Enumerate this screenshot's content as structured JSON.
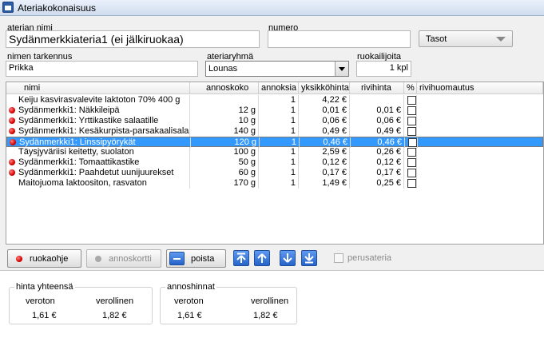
{
  "window": {
    "title": "Ateriakokonaisuus"
  },
  "form": {
    "aterian_nimi_label": "aterian nimi",
    "aterian_nimi": "Sydänmerkkiateria1 (ei jälkiruokaa)",
    "numero_label": "numero",
    "numero": "",
    "tasot": "Tasot",
    "nimen_tarkennus_label": "nimen tarkennus",
    "nimen_tarkennus": "Prikka",
    "ateriaryhma_label": "ateriaryhmä",
    "ateriaryhma": "Lounas",
    "ruokailijoita_label": "ruokailijoita",
    "ruokailijoita": "1 kpl"
  },
  "table": {
    "headers": [
      "nimi",
      "annoskoko",
      "annoksia",
      "yksikköhinta",
      "rivihinta",
      "%",
      "rivihuomautus"
    ],
    "rows": [
      {
        "mark": false,
        "nimi": "Keiju kasvirasvalevite laktoton 70% 400 g",
        "annoskoko": "",
        "annoksia": "1",
        "yksikkohinta": "4,22 €",
        "rivihinta": "",
        "selected": false
      },
      {
        "mark": true,
        "nimi": "Sydänmerkki1: Näkkileipä",
        "annoskoko": "12 g",
        "annoksia": "1",
        "yksikkohinta": "0,01 €",
        "rivihinta": "0,01 €",
        "selected": false
      },
      {
        "mark": true,
        "nimi": "Sydänmerkki1: Yrttikastike salaatille",
        "annoskoko": "10 g",
        "annoksia": "1",
        "yksikkohinta": "0,06 €",
        "rivihinta": "0,06 €",
        "selected": false
      },
      {
        "mark": true,
        "nimi": "Sydänmerkki1: Kesäkurpista-parsakaalisalaa",
        "annoskoko": "140 g",
        "annoksia": "1",
        "yksikkohinta": "0,49 €",
        "rivihinta": "0,49 €",
        "selected": false
      },
      {
        "mark": true,
        "nimi": "Sydänmerkki1: Linssipyörykät",
        "annoskoko": "120 g",
        "annoksia": "1",
        "yksikkohinta": "0,46 €",
        "rivihinta": "0,46 €",
        "selected": true
      },
      {
        "mark": false,
        "nimi": "Täysjyväriisi keitetty, suolaton",
        "annoskoko": "100 g",
        "annoksia": "1",
        "yksikkohinta": "2,59 €",
        "rivihinta": "0,26 €",
        "selected": false
      },
      {
        "mark": true,
        "nimi": "Sydänmerkki1: Tomaattikastike",
        "annoskoko": "50 g",
        "annoksia": "1",
        "yksikkohinta": "0,12 €",
        "rivihinta": "0,12 €",
        "selected": false
      },
      {
        "mark": true,
        "nimi": "Sydänmerkki1: Paahdetut uunijuurekset",
        "annoskoko": "60 g",
        "annoksia": "1",
        "yksikkohinta": "0,17 €",
        "rivihinta": "0,17 €",
        "selected": false
      },
      {
        "mark": false,
        "nimi": "Maitojuoma laktoositon, rasvaton",
        "annoskoko": "170 g",
        "annoksia": "1",
        "yksikkohinta": "1,49 €",
        "rivihinta": "0,25 €",
        "selected": false
      }
    ]
  },
  "buttons": {
    "ruokaohje": "ruokaohje",
    "annoskortti": "annoskortti",
    "poista": "poista",
    "perusateria": "perusateria"
  },
  "totals": {
    "hinta_title": "hinta yhteensä",
    "veroton_label": "veroton",
    "verollinen_label": "verollinen",
    "veroton": "1,61 €",
    "verollinen": "1,82 €",
    "annos_title": "annoshinnat",
    "annos_veroton": "1,61 €",
    "annos_verollinen": "1,82 €"
  }
}
